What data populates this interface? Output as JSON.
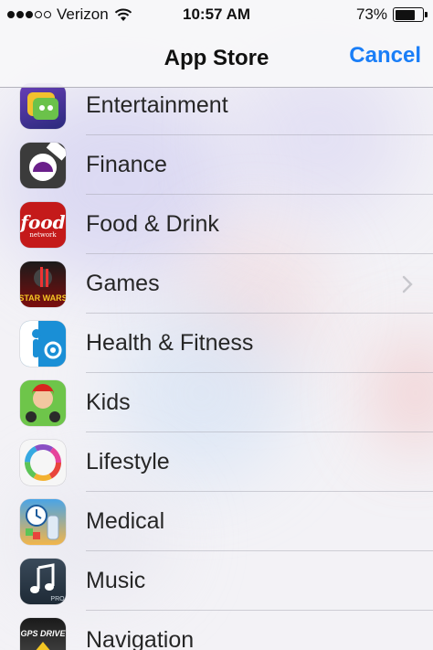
{
  "status_bar": {
    "carrier": "Verizon",
    "signal_bars_filled": 3,
    "signal_bars_total": 5,
    "time": "10:57 AM",
    "battery_text": "73%",
    "battery_level": 0.73
  },
  "nav": {
    "title": "App Store",
    "cancel_label": "Cancel"
  },
  "categories": [
    {
      "label": "Entertainment",
      "icon": "entertainment-app-icon"
    },
    {
      "label": "Finance",
      "icon": "finance-app-icon"
    },
    {
      "label": "Food & Drink",
      "icon": "food-network-icon",
      "icon_text": "food",
      "icon_subtext": "network"
    },
    {
      "label": "Games",
      "icon": "star-wars-game-icon",
      "icon_text": "STAR WARS",
      "has_chevron": true
    },
    {
      "label": "Health & Fitness",
      "icon": "fitness-app-icon"
    },
    {
      "label": "Kids",
      "icon": "kids-app-icon"
    },
    {
      "label": "Lifestyle",
      "icon": "color-wheel-icon"
    },
    {
      "label": "Medical",
      "icon": "medical-app-icon"
    },
    {
      "label": "Music",
      "icon": "music-note-icon",
      "icon_text": "PRO"
    },
    {
      "label": "Navigation",
      "icon": "gps-drive-icon",
      "icon_text": "GPS DRIVE"
    }
  ],
  "colors": {
    "accent": "#1a7ef7",
    "label_text": "#262626"
  }
}
